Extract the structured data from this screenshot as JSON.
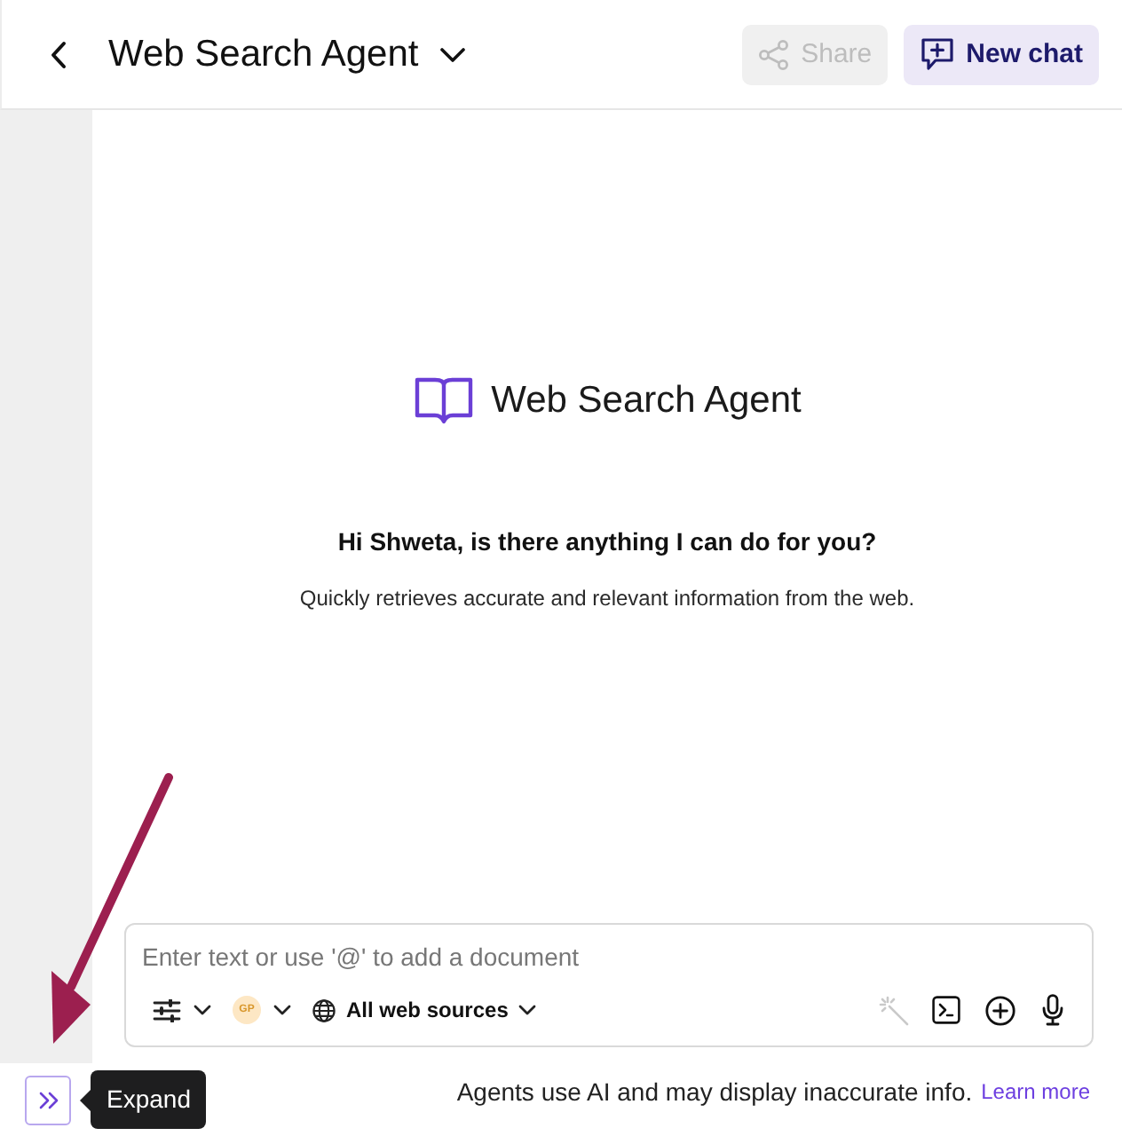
{
  "header": {
    "title": "Web Search Agent",
    "buttons": [
      {
        "kind": "share",
        "label": "Share",
        "disabled": true
      },
      {
        "kind": "new-chat",
        "label": "New chat",
        "disabled": false
      }
    ]
  },
  "agent": {
    "name": "Web Search Agent",
    "greeting": "Hi Shweta, is there anything I can do for you?",
    "description": "Quickly retrieves accurate and relevant information from the web."
  },
  "composer": {
    "placeholder": "Enter text or use '@' to add a document",
    "avatar": "GP",
    "source": "All web sources",
    "tools": [
      {
        "kind": "wand",
        "disabled": true
      },
      {
        "kind": "terminal",
        "disabled": false
      },
      {
        "kind": "add",
        "disabled": false
      },
      {
        "kind": "mic",
        "disabled": false
      }
    ]
  },
  "sidebar": {
    "tooltip": "Expand"
  },
  "footer": {
    "notice": "Agents use AI and may display inaccurate info.",
    "link": "Learn more"
  }
}
